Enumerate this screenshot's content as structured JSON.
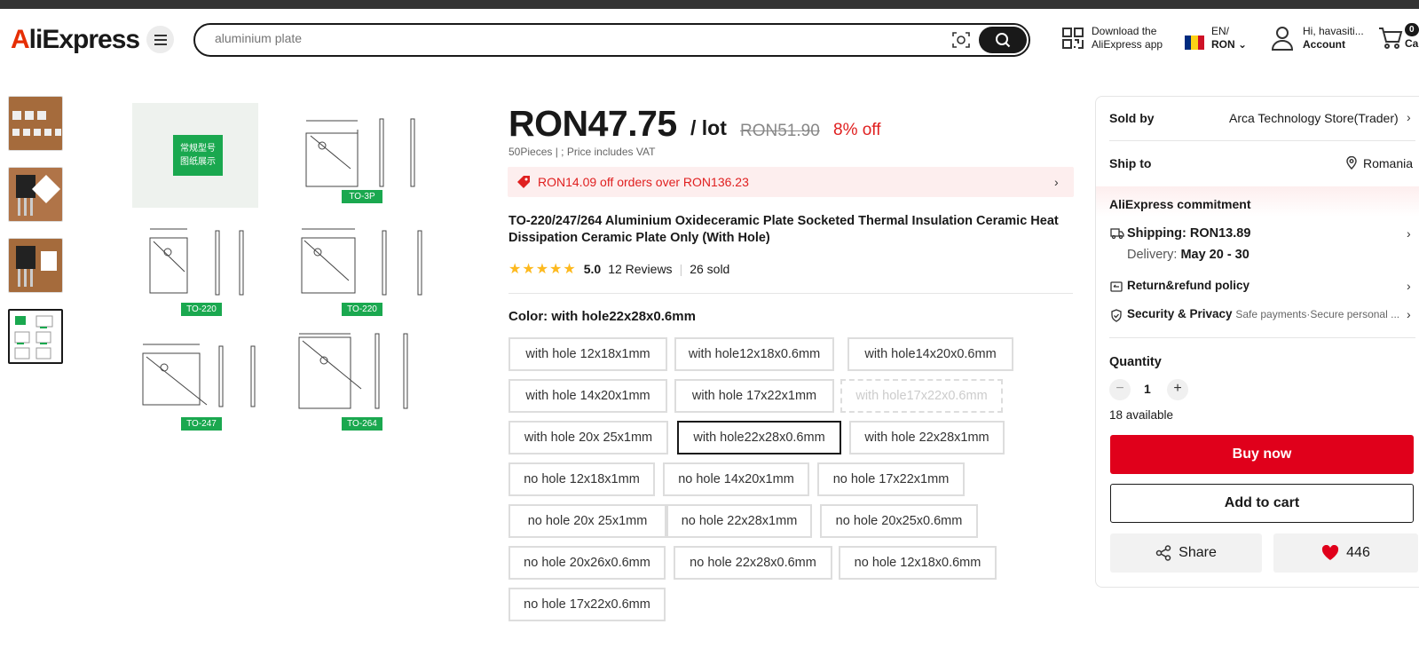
{
  "header": {
    "logo": "AliExpress",
    "search_placeholder": "aluminium plate",
    "download_line1": "Download the",
    "download_line2": "AliExpress app",
    "lang_line1": "EN/",
    "lang_line2": "RON",
    "account_line1": "Hi, havasiti...",
    "account_line2": "Account",
    "cart_count": "0",
    "cart_label": "Ca"
  },
  "gallery": {
    "tags": [
      "TO-3P",
      "TO-220",
      "TO-220",
      "TO-247",
      "TO-264"
    ],
    "chinese_label_1": "常规型号",
    "chinese_label_2": "图纸展示"
  },
  "product": {
    "price": "RON47.75",
    "per_unit": "/ lot",
    "original_price": "RON51.90",
    "discount": "8% off",
    "sub_info": "50Pieces | ; Price includes VAT",
    "promo": "RON14.09 off orders over RON136.23",
    "title": "TO-220/247/264 Aluminium Oxideceramic Plate Socketed Thermal Insulation Ceramic Heat Dissipation Ceramic Plate Only (With Hole)",
    "rating": "5.0",
    "reviews": "12 Reviews",
    "sold": "26 sold",
    "color_label": "Color: with hole22x28x0.6mm",
    "options": [
      "with hole 12x18x1mm",
      "with hole12x18x0.6mm",
      "with hole14x20x0.6mm",
      "with hole 14x20x1mm",
      "with hole 17x22x1mm",
      "with hole17x22x0.6mm",
      "with hole 20x 25x1mm",
      "with hole22x28x0.6mm",
      "with hole 22x28x1mm",
      "no hole 12x18x1mm",
      "no hole 14x20x1mm",
      "no hole 17x22x1mm",
      "no hole 20x 25x1mm",
      "no hole 22x28x1mm",
      "no hole 20x25x0.6mm",
      "no hole 20x26x0.6mm",
      "no hole 22x28x0.6mm",
      "no hole 12x18x0.6mm",
      "no hole 17x22x0.6mm"
    ],
    "selected_option": "with hole22x28x0.6mm",
    "disabled_option": "with hole17x22x0.6mm"
  },
  "panel": {
    "sold_by_label": "Sold by",
    "store": "Arca Technology Store(Trader)",
    "ship_to_label": "Ship to",
    "country": "Romania",
    "commitment": "AliExpress commitment",
    "shipping": "Shipping: RON13.89",
    "delivery_label": "Delivery:",
    "delivery_dates": "May 20 - 30",
    "return_policy": "Return&refund policy",
    "security": "Security & Privacy",
    "security_sub": "Safe payments·Secure personal ...",
    "quantity_label": "Quantity",
    "quantity": "1",
    "available": "18 available",
    "buy_now": "Buy now",
    "add_to_cart": "Add to cart",
    "share": "Share",
    "wishlist_count": "446"
  },
  "colors": {
    "brand_red": "#e0001b",
    "discount_red": "#e02020",
    "star": "#fdb91e",
    "tag_green": "#1aa84f"
  }
}
